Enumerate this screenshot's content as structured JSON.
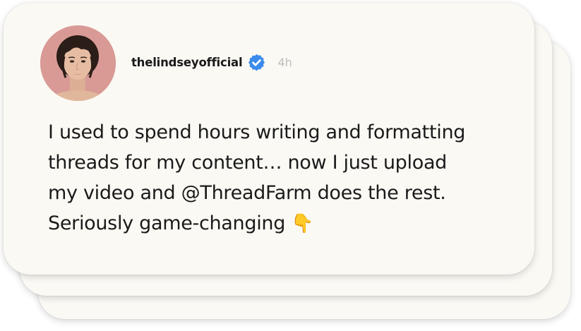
{
  "post": {
    "username": "thelindseyofficial",
    "time": "4h",
    "text_lines": [
      "I used to spend hours writing and formatting",
      "threads for my content… now I just upload",
      "my video and @ThreadFarm does the rest.",
      "Seriously game-changing"
    ],
    "emoji": "👇",
    "avatar_icon": "profile-photo",
    "verified_icon": "verified-badge-icon"
  },
  "colors": {
    "card_background": "#fbf9f4",
    "verified_blue": "#3b8beb",
    "timestamp_gray": "#bdbdbd",
    "avatar_background": "#d99a96"
  }
}
